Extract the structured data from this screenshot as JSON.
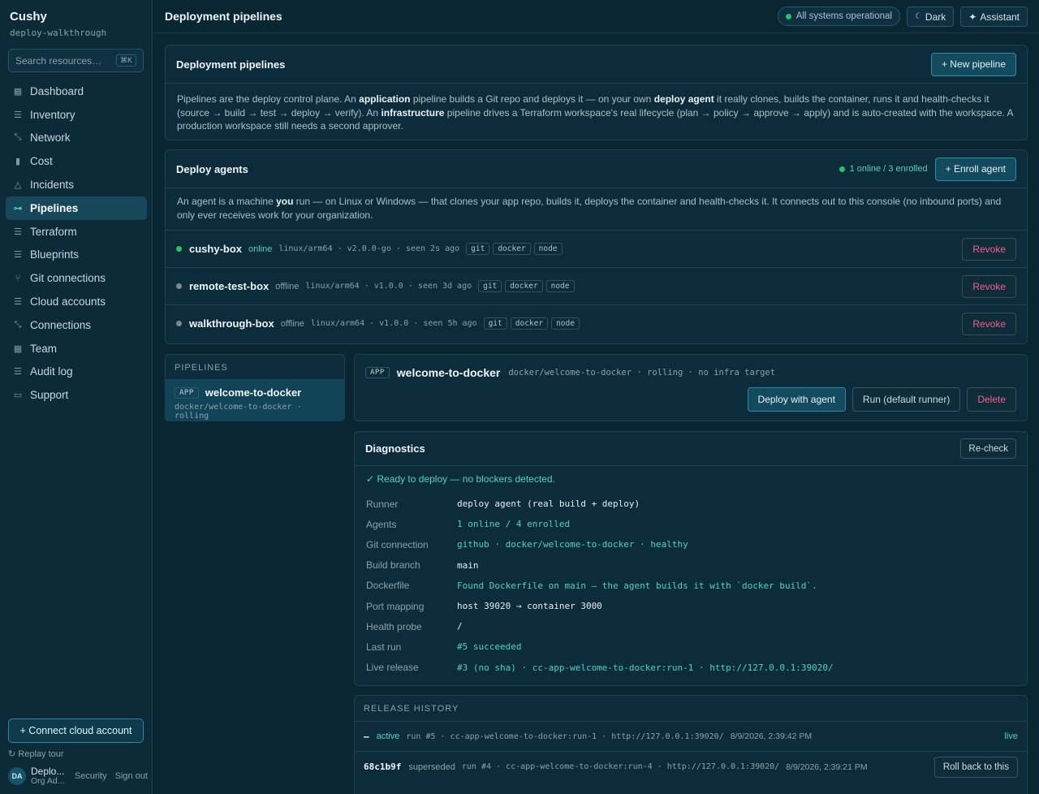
{
  "app": {
    "name": "Cushy",
    "workspace": "deploy-walkthrough"
  },
  "search": {
    "placeholder": "Search resources…",
    "shortcut": "⌘K"
  },
  "sidebar": {
    "items": [
      {
        "label": "Dashboard",
        "icon": "grid-icon"
      },
      {
        "label": "Inventory",
        "icon": "list-icon"
      },
      {
        "label": "Network",
        "icon": "network-icon"
      },
      {
        "label": "Cost",
        "icon": "bar-chart-icon"
      },
      {
        "label": "Incidents",
        "icon": "warning-icon"
      },
      {
        "label": "Pipelines",
        "icon": "pipeline-icon"
      },
      {
        "label": "Terraform",
        "icon": "stack-icon"
      },
      {
        "label": "Blueprints",
        "icon": "stack-icon"
      },
      {
        "label": "Git connections",
        "icon": "branch-icon"
      },
      {
        "label": "Cloud accounts",
        "icon": "stack-icon"
      },
      {
        "label": "Connections",
        "icon": "network-icon"
      },
      {
        "label": "Team",
        "icon": "grid-icon"
      },
      {
        "label": "Audit log",
        "icon": "list-icon"
      },
      {
        "label": "Support",
        "icon": "chat-icon"
      }
    ],
    "active": "Pipelines",
    "connect_label": "+ Connect cloud account",
    "replay_label": "Replay tour",
    "user": {
      "initials": "DA",
      "name": "Deplo...",
      "role": "Org Ad...",
      "security": "Security",
      "signout": "Sign out"
    }
  },
  "header": {
    "title": "Deployment pipelines",
    "status": "All systems operational",
    "theme": "Dark",
    "assistant": "Assistant"
  },
  "pipelines_card": {
    "title": "Deployment pipelines",
    "new_label": "+ New pipeline"
  },
  "agents_card": {
    "title": "Deploy agents",
    "summary": "1 online / 3 enrolled",
    "enroll_label": "+ Enroll agent",
    "revoke_label": "Revoke",
    "agents": [
      {
        "name": "cushy-box",
        "status": "online",
        "meta": "linux/arm64 · v2.0.0-go · seen 2s ago",
        "tags": [
          "git",
          "docker",
          "node"
        ]
      },
      {
        "name": "remote-test-box",
        "status": "offline",
        "meta": "linux/arm64 · v1.0.0 · seen 3d ago",
        "tags": [
          "git",
          "docker",
          "node"
        ]
      },
      {
        "name": "walkthrough-box",
        "status": "offline",
        "meta": "linux/arm64 · v1.0.0 · seen 5h ago",
        "tags": [
          "git",
          "docker",
          "node"
        ]
      }
    ]
  },
  "pipelines_list": {
    "heading": "PIPELINES",
    "items": [
      {
        "badge": "APP",
        "name": "welcome-to-docker",
        "meta": "docker/welcome-to-docker · rolling"
      }
    ]
  },
  "pipeline_detail": {
    "badge": "APP",
    "name": "welcome-to-docker",
    "meta": "docker/welcome-to-docker · rolling · no infra target",
    "deploy_label": "Deploy with agent",
    "run_label": "Run (default runner)",
    "delete_label": "Delete"
  },
  "diagnostics": {
    "title": "Diagnostics",
    "recheck_label": "Re-check",
    "ready": "✓ Ready to deploy — no blockers detected.",
    "rows": [
      {
        "key": "Runner",
        "value": "deploy agent (real build + deploy)",
        "ok": false
      },
      {
        "key": "Agents",
        "value": "1 online / 4 enrolled",
        "ok": true
      },
      {
        "key": "Git connection",
        "value": "github · docker/welcome-to-docker · healthy",
        "ok": true
      },
      {
        "key": "Build branch",
        "value": "main",
        "ok": false
      },
      {
        "key": "Dockerfile",
        "value": "Found Dockerfile on main — the agent builds it with `docker build`.",
        "ok": true
      },
      {
        "key": "Port mapping",
        "value": "host 39020 → container 3000",
        "ok": false
      },
      {
        "key": "Health probe",
        "value": "/",
        "ok": false
      },
      {
        "key": "Last run",
        "value": "#5 succeeded",
        "ok": true
      },
      {
        "key": "Live release",
        "value": "#3 (no sha) · cc-app-welcome-to-docker:run-1 · http://127.0.0.1:39020/",
        "ok": true
      }
    ]
  },
  "release_history": {
    "heading": "RELEASE HISTORY",
    "rows": [
      {
        "sha": "—",
        "state": "active",
        "detail": "run #5 · cc-app-welcome-to-docker:run-1 · http://127.0.0.1:39020/",
        "time": "8/9/2026, 2:39:42 PM",
        "action": "live"
      },
      {
        "sha": "68c1b9f",
        "state": "superseded",
        "detail": "run #4 · cc-app-welcome-to-docker:run-4 · http://127.0.0.1:39020/",
        "time": "8/9/2026, 2:39:21 PM",
        "action": "Roll back to this"
      }
    ]
  },
  "colors": {
    "accent": "#4fd1c5",
    "online": "#22c55e",
    "danger": "#f0618a",
    "muted": "#8aa1ad"
  }
}
